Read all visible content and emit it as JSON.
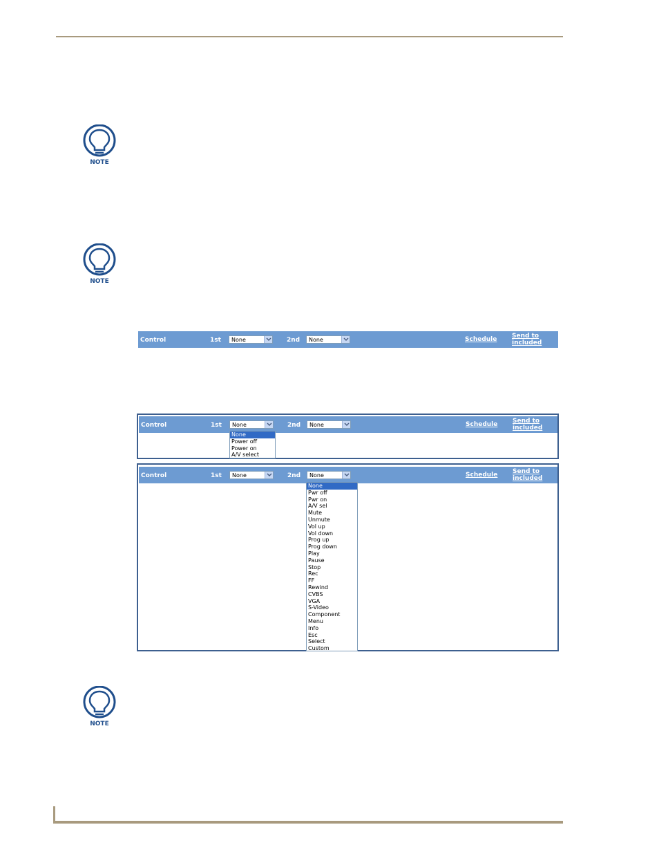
{
  "note_label": "NOTE",
  "bar_labels": {
    "control": "Control",
    "first": "1st",
    "second": "2nd",
    "schedule": "Schedule",
    "send_to_line1": "Send to",
    "send_to_line2": "included"
  },
  "select_values": {
    "first": "None",
    "second": "None"
  },
  "dropdown_first_options": [
    "None",
    "Power off",
    "Power on",
    "A/V select"
  ],
  "dropdown_second_options": [
    "None",
    "Pwr off",
    "Pwr on",
    "A/V sel",
    "Mute",
    "Unmute",
    "Vol up",
    "Vol down",
    "Prog up",
    "Prog down",
    "Play",
    "Pause",
    "Stop",
    "Rec",
    "FF",
    "Rewind",
    "CVBS",
    "VGA",
    "S-Video",
    "Component",
    "Menu",
    "Info",
    "Esc",
    "Select",
    "Custom"
  ],
  "colors": {
    "bar": "#6d9bd2",
    "rule": "#a89a7e",
    "frame": "#3d5f8f",
    "selected_option": "#316ac5"
  },
  "icons": [
    "lightbulb-icon",
    "chevron-down-icon"
  ]
}
